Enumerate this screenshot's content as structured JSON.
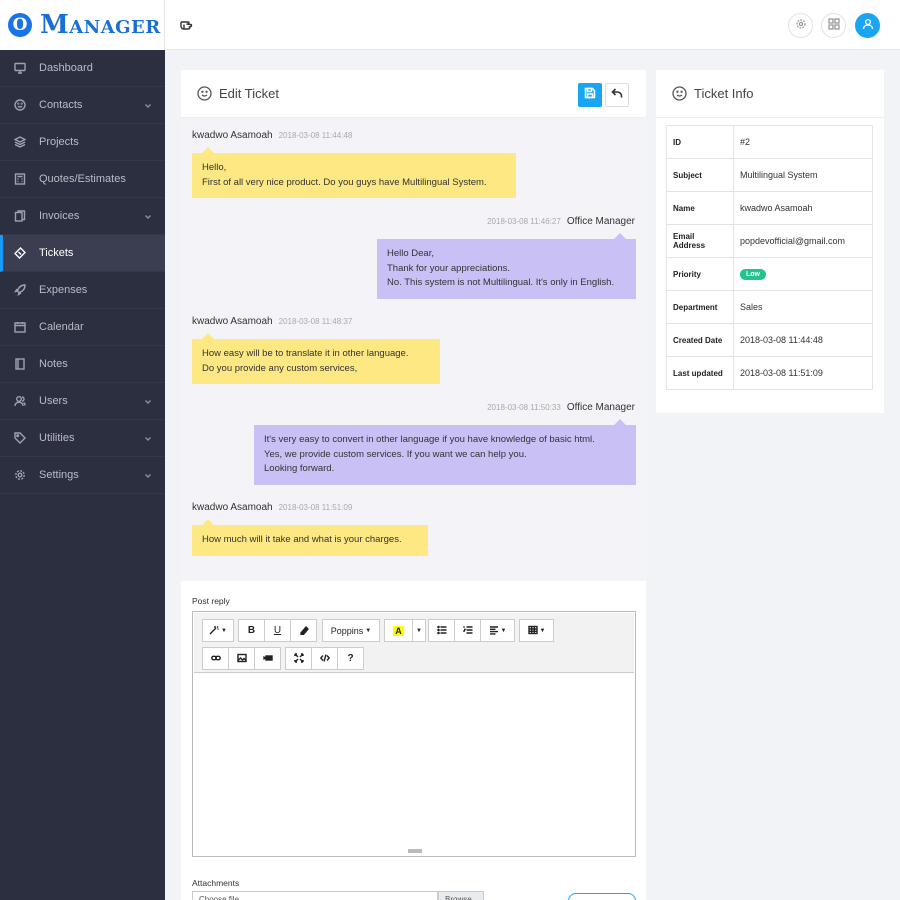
{
  "brand": {
    "badge": "O",
    "name": "Manager"
  },
  "sidebar": {
    "items": [
      {
        "label": "Dashboard",
        "icon": "monitor-icon",
        "has_children": false,
        "active": false
      },
      {
        "label": "Contacts",
        "icon": "smile-icon",
        "has_children": true,
        "active": false
      },
      {
        "label": "Projects",
        "icon": "layers-icon",
        "has_children": false,
        "active": false
      },
      {
        "label": "Quotes/Estimates",
        "icon": "calculator-icon",
        "has_children": false,
        "active": false
      },
      {
        "label": "Invoices",
        "icon": "files-icon",
        "has_children": true,
        "active": false
      },
      {
        "label": "Tickets",
        "icon": "ticket-icon",
        "has_children": false,
        "active": true
      },
      {
        "label": "Expenses",
        "icon": "rocket-icon",
        "has_children": false,
        "active": false
      },
      {
        "label": "Calendar",
        "icon": "calendar-icon",
        "has_children": false,
        "active": false
      },
      {
        "label": "Notes",
        "icon": "notebook-icon",
        "has_children": false,
        "active": false
      },
      {
        "label": "Users",
        "icon": "users-icon",
        "has_children": true,
        "active": false
      },
      {
        "label": "Utilities",
        "icon": "tag-icon",
        "has_children": true,
        "active": false
      },
      {
        "label": "Settings",
        "icon": "gear-icon",
        "has_children": true,
        "active": false
      }
    ]
  },
  "topbar": {
    "toggle_icon": "hand-pointer-icon",
    "settings_icon": "gear-icon",
    "apps_icon": "grid-icon",
    "profile_icon": "user-icon"
  },
  "edit_ticket": {
    "title": "Edit Ticket",
    "messages": [
      {
        "author": "kwadwo Asamoah",
        "time": "2018-03-08 11:44:48",
        "side": "left",
        "lines": [
          "Hello,",
          "First of all very nice product. Do you guys have Multilingual System."
        ]
      },
      {
        "author": "Office Manager",
        "time": "2018-03-08 11:46:27",
        "side": "right",
        "lines": [
          "Hello Dear,",
          "Thank for your appreciations.",
          "No. This system is not Multilingual. It's only in English."
        ]
      },
      {
        "author": "kwadwo Asamoah",
        "time": "2018-03-08 11:48:37",
        "side": "left",
        "lines": [
          "How easy will be to translate it in other language.",
          "Do you provide any custom services,"
        ]
      },
      {
        "author": "Office Manager",
        "time": "2018-03-08 11:50:33",
        "side": "right",
        "lines": [
          "It's very easy to convert in other language if you have knowledge of basic html.",
          "Yes, we provide custom services. If you want we can help you.",
          "Looking forward."
        ]
      },
      {
        "author": "kwadwo Asamoah",
        "time": "2018-03-08 11:51:09",
        "side": "left",
        "lines": [
          "How much will it take and what is your charges."
        ]
      }
    ],
    "reply_label": "Post reply",
    "font_select": "Poppins",
    "highlight_letter": "A",
    "attachments_label": "Attachments",
    "file_placeholder": "Choose file",
    "browse_label": "Browse"
  },
  "ticket_info": {
    "title": "Ticket Info",
    "rows": [
      {
        "key": "ID",
        "value": "#2"
      },
      {
        "key": "Subject",
        "value": "Multilingual System"
      },
      {
        "key": "Name",
        "value": "kwadwo Asamoah"
      },
      {
        "key": "Email Address",
        "value": "popdevofficial@gmail.com"
      },
      {
        "key": "Priority",
        "value": "Low"
      },
      {
        "key": "Department",
        "value": "Sales"
      },
      {
        "key": "Created Date",
        "value": "2018-03-08 11:44:48"
      },
      {
        "key": "Last updated",
        "value": "2018-03-08 11:51:09"
      }
    ]
  },
  "colors": {
    "primary": "#1aa5f2",
    "sidebar_bg": "#2c2f3f",
    "client_bubble": "#fde883",
    "staff_bubble": "#c9c0f5",
    "priority_low": "#21c48d"
  }
}
